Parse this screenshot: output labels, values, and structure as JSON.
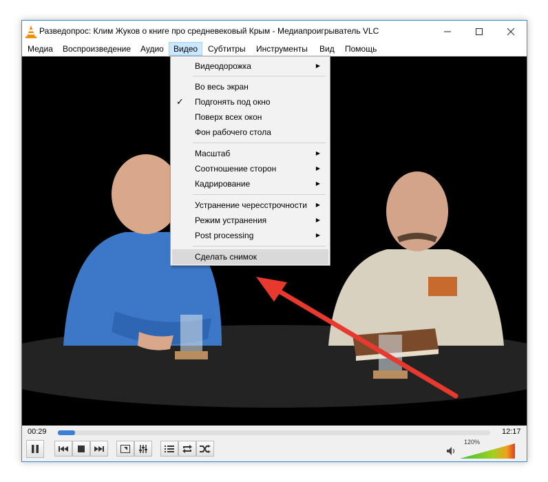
{
  "window": {
    "title": "Разведопрос: Клим Жуков о книге про средневековый Крым - Медиапроигрыватель VLC"
  },
  "menubar": {
    "items": [
      {
        "label": "Медиа"
      },
      {
        "label": "Воспроизведение"
      },
      {
        "label": "Аудио"
      },
      {
        "label": "Видео"
      },
      {
        "label": "Субтитры"
      },
      {
        "label": "Инструменты"
      },
      {
        "label": "Вид"
      },
      {
        "label": "Помощь"
      }
    ]
  },
  "video_menu": {
    "items": [
      {
        "label": "Видеодорожка",
        "submenu": true
      },
      {
        "label": "Во весь экран"
      },
      {
        "label": "Подгонять под окно",
        "checked": true
      },
      {
        "label": "Поверх всех окон"
      },
      {
        "label": "Фон рабочего стола"
      },
      {
        "label": "Масштаб",
        "submenu": true
      },
      {
        "label": "Соотношение сторон",
        "submenu": true
      },
      {
        "label": "Кадрирование",
        "submenu": true
      },
      {
        "label": "Устранение чересстрочности",
        "submenu": true
      },
      {
        "label": "Режим устранения",
        "submenu": true
      },
      {
        "label": "Post processing",
        "submenu": true
      },
      {
        "label": "Сделать снимок",
        "highlighted": true
      }
    ]
  },
  "controls": {
    "elapsed": "00:29",
    "total": "12:17",
    "progress_fraction": 0.04,
    "volume_label": "120%",
    "volume_fraction": 1.0
  },
  "colors": {
    "accent": "#3d7fd0",
    "annotation_arrow": "#e8392f",
    "menu_highlight": "#cce8ff"
  }
}
